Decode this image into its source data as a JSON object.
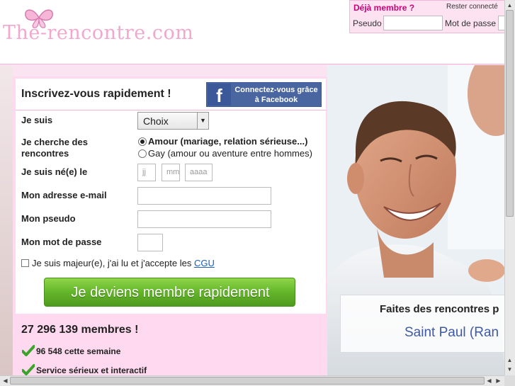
{
  "site": {
    "logo_text": "The-rencontre.com"
  },
  "login": {
    "title": "Déjà membre ?",
    "stay_connected": "Rester connecté",
    "pseudo_label": "Pseudo",
    "password_label": "Mot de passe"
  },
  "form": {
    "title": "Inscrivez-vous rapidement !",
    "facebook_button": "Connectez-vous grâce à Facebook",
    "facebook_icon": "f",
    "je_suis_label": "Je suis",
    "je_suis_value": "Choix",
    "cherche_label": "Je cherche des rencontres",
    "option_amour": "Amour (mariage, relation sérieuse...)",
    "option_gay": "Gay (amour ou aventure entre hommes)",
    "birth_label": "Je suis né(e) le",
    "day_placeholder": "jj",
    "month_placeholder": "mm",
    "year_placeholder": "aaaa",
    "email_label": "Mon adresse e-mail",
    "pseudo_label": "Mon pseudo",
    "password_label": "Mon mot de passe",
    "cgu_text": "Je suis majeur(e), j'ai lu et j'accepte les",
    "cgu_link": "CGU",
    "submit": "Je deviens membre rapidement"
  },
  "stats": {
    "members": "27 296 139 membres !",
    "week": "96 548 cette semaine",
    "service": "Service sérieux et interactif"
  },
  "overlay": {
    "title": "Faites des rencontres p",
    "city": "Saint Paul (Ran"
  },
  "colors": {
    "pink_band": "#fbe4f1",
    "form_pink": "#ffd9ef",
    "brand_pink": "#cc0077",
    "facebook": "#3b5998",
    "cta_green": "#63b52a",
    "link_blue": "#1a5fbf"
  }
}
